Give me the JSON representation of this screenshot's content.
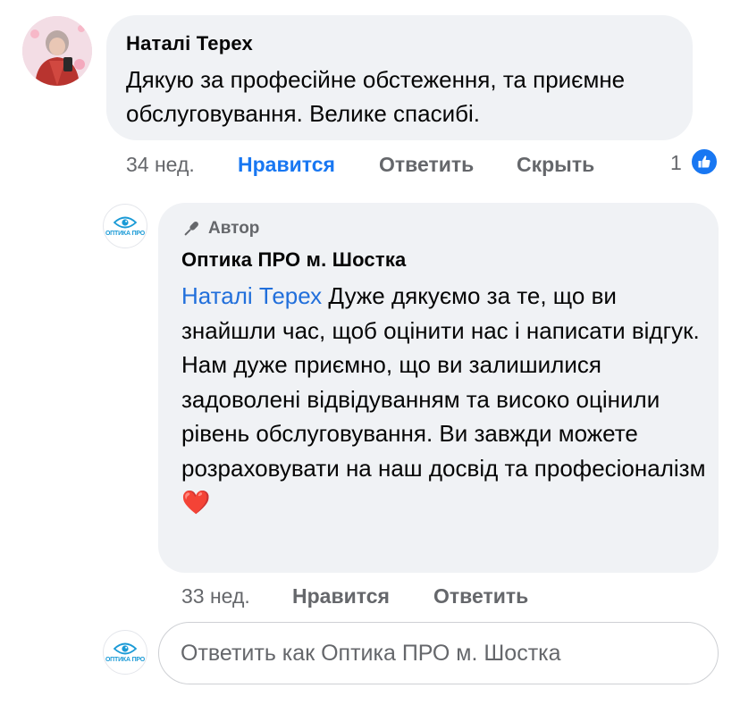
{
  "comment": {
    "author": "Наталі Терех",
    "text": "Дякую за професійне обстеження, та приємне обслуговування. Велике спасибі.",
    "time": "34 нед.",
    "actions": {
      "like": "Нравится",
      "reply": "Ответить",
      "hide": "Скрыть"
    },
    "like_count": "1"
  },
  "reply": {
    "badge": "Автор",
    "author": "Оптика ПРО м. Шостка",
    "mention": "Наталі Терех",
    "text": "Дуже дякуємо за те, що ви знайшли час, щоб оцінити нас і написати відгук. Нам дуже приємно, що ви залишилися задоволені відвідуванням та високо оцінили рівень обслуговування. Ви завжди можете розраховувати на наш досвід та професіоналізм",
    "emoji": "❤️",
    "time": "33 нед.",
    "actions": {
      "like": "Нравится",
      "reply": "Ответить"
    },
    "logo_text": "ОПТИКА ПРО"
  },
  "compose": {
    "placeholder": "Ответить как Оптика ПРО м. Шостка"
  },
  "colors": {
    "accent": "#1877f2",
    "bubble": "#f0f2f5",
    "secondary_text": "#65676b",
    "logo": "#1a9ad6"
  }
}
